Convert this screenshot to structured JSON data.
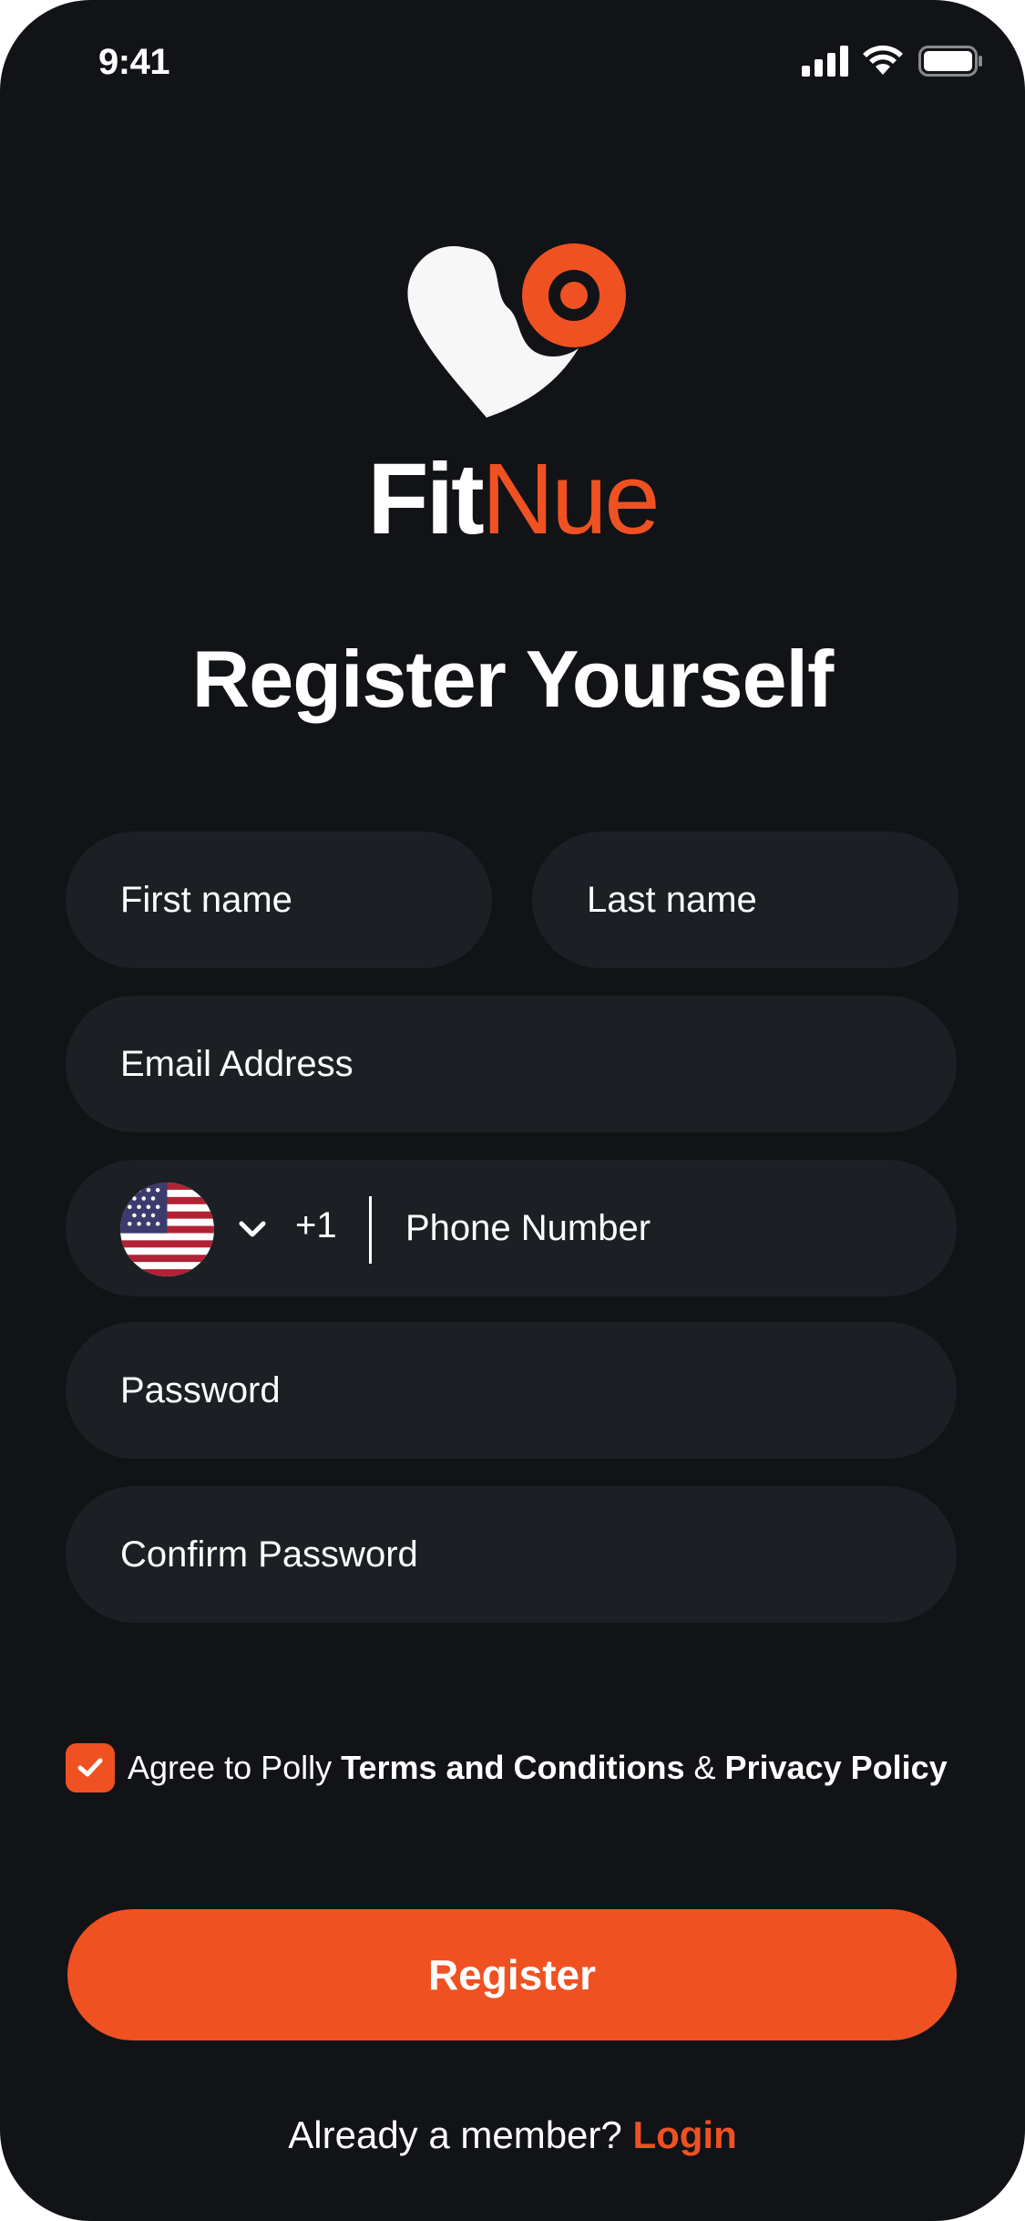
{
  "status_bar": {
    "time": "9:41",
    "icons": [
      "signal-icon",
      "wifi-icon",
      "battery-icon"
    ]
  },
  "brand": {
    "part1": "Fit",
    "part2": "Nue",
    "accent_color": "#f05122"
  },
  "title": "Register Yourself",
  "form": {
    "first_name_placeholder": "First name",
    "last_name_placeholder": "Last name",
    "email_placeholder": "Email Address",
    "phone": {
      "country_flag": "us-flag-icon",
      "dial_code": "+1",
      "placeholder": "Phone Number"
    },
    "password_placeholder": "Password",
    "confirm_password_placeholder": "Confirm Password"
  },
  "agreement": {
    "checked": true,
    "prefix": "Agree to Polly ",
    "terms": "Terms and Conditions",
    "amp": " & ",
    "privacy": "Privacy Policy"
  },
  "register_label": "Register",
  "login_prompt": {
    "text": "Already a member? ",
    "link": "Login"
  },
  "colors": {
    "background": "#111317",
    "field": "#1c1f24",
    "accent": "#f05122"
  }
}
